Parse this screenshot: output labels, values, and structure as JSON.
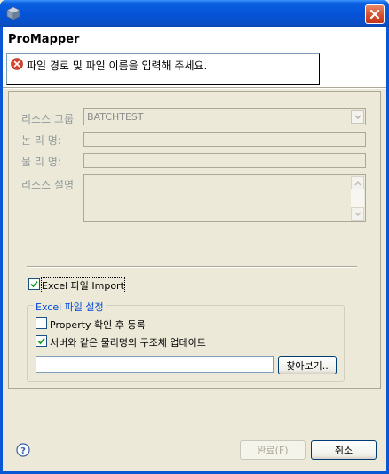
{
  "window": {
    "title": ""
  },
  "header": {
    "app_title": "ProMapper",
    "message": "파일 경로 및 파일 이름을 입력해 주세요."
  },
  "form": {
    "resource_group_label": "리소스 그룹",
    "resource_group_value": "BATCHTEST",
    "logical_name_label": "논 리 명:",
    "logical_name_value": "",
    "physical_name_label": "물 리 명:",
    "physical_name_value": "",
    "resource_desc_label": "리소스 설명",
    "resource_desc_value": ""
  },
  "excel": {
    "import_label": "Excel 파일 Import",
    "import_checked": true,
    "group_title": "Excel 파일 설정",
    "property_label": "Property 확인 후 등록",
    "property_checked": false,
    "update_label": "서버와 같은 물리명의 구조체 업데이트",
    "update_checked": true,
    "file_path_value": "",
    "browse_label": "찾아보기.."
  },
  "footer": {
    "finish_label": "완료(F)",
    "cancel_label": "취소"
  },
  "icons": {
    "app": "app-cube-icon",
    "close": "close-icon",
    "error": "error-icon",
    "help": "help-icon",
    "check": "check-icon",
    "dropdown": "chevron-down-icon"
  },
  "colors": {
    "titlebar": "#0553d8",
    "dialog_bg": "#ece9d8",
    "error": "#d6422b",
    "group_title": "#0046d5"
  }
}
